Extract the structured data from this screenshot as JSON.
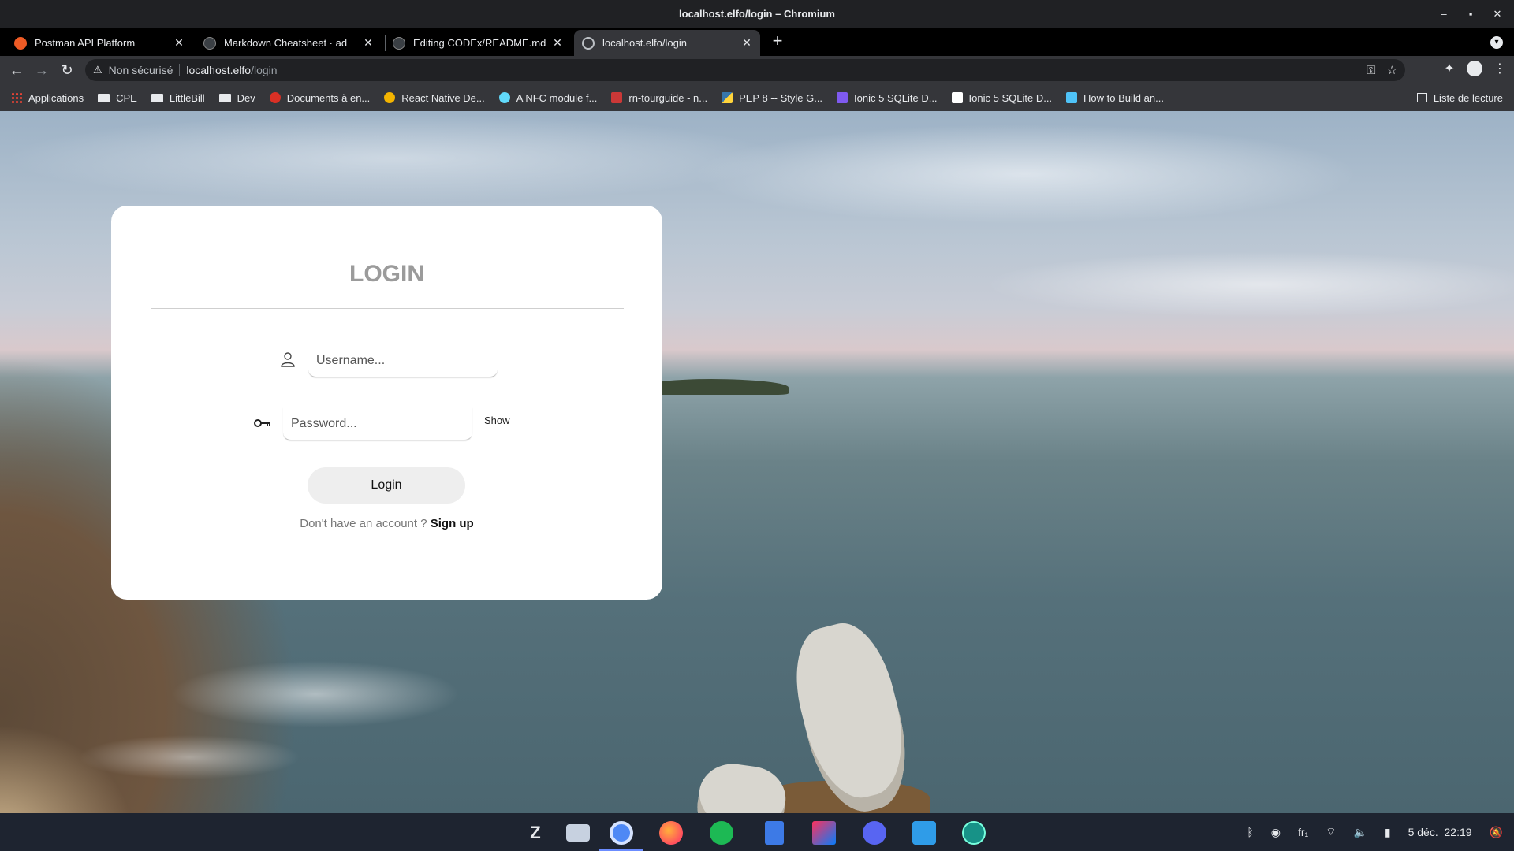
{
  "window": {
    "title": "localhost.elfo/login – Chromium",
    "controls": [
      "–",
      "▪",
      "✕"
    ]
  },
  "tabs": [
    {
      "label": "Postman API Platform",
      "favicon_color": "#ef5b25",
      "active": false
    },
    {
      "label": "Markdown Cheatsheet · ad",
      "favicon_color": "#24292e",
      "active": false
    },
    {
      "label": "Editing CODEx/README.md",
      "favicon_color": "#24292e",
      "active": false
    },
    {
      "label": "localhost.elfo/login",
      "favicon_color": "#9aa0a6",
      "active": true
    }
  ],
  "toolbar": {
    "back": "←",
    "forward": "→",
    "reload": "↻",
    "warning_icon": "⚠",
    "security_label": "Non sécurisé",
    "url_host": "localhost.elfo",
    "url_path": "/login",
    "key_icon": "⚿",
    "star_icon": "☆",
    "extensions_icon": "✦",
    "menu_icon": "⋮"
  },
  "bookmarks": [
    {
      "label": "Applications",
      "type": "apps",
      "color": "#ea4335"
    },
    {
      "label": "CPE",
      "type": "folder"
    },
    {
      "label": "LittleBill",
      "type": "folder"
    },
    {
      "label": "Dev",
      "type": "folder"
    },
    {
      "label": "Documents à en...",
      "type": "site",
      "color": "#d93025"
    },
    {
      "label": "React Native De...",
      "type": "site",
      "color": "#f4b400"
    },
    {
      "label": "A NFC module f...",
      "type": "site",
      "color": "#61dafb"
    },
    {
      "label": "rn-tourguide - n...",
      "type": "site",
      "color": "#cb3837"
    },
    {
      "label": "PEP 8 -- Style G...",
      "type": "site",
      "color": "#3776ab"
    },
    {
      "label": "Ionic 5 SQLite D...",
      "type": "site",
      "color": "#7f5af0"
    },
    {
      "label": "Ionic 5 SQLite D...",
      "type": "site",
      "color": "#ffffff"
    },
    {
      "label": "How to Build an...",
      "type": "site",
      "color": "#4fc3f7"
    }
  ],
  "reading_list": "Liste de lecture",
  "login": {
    "title": "LOGIN",
    "username_placeholder": "Username...",
    "password_placeholder": "Password...",
    "show_label": "Show",
    "login_button": "Login",
    "signup_prompt": "Don't have an account ? ",
    "signup_link": "Sign up",
    "username_icon": "user-icon",
    "password_icon": "key-icon"
  },
  "taskbar": {
    "apps": [
      {
        "name": "zorin-menu-icon",
        "color": "#e8eaed"
      },
      {
        "name": "files-icon",
        "color": "#c7d1e0"
      },
      {
        "name": "chromium-icon",
        "color": "#4e88f5",
        "active": true
      },
      {
        "name": "firefox-icon",
        "color": "#ff7139"
      },
      {
        "name": "spotify-icon",
        "color": "#1db954"
      },
      {
        "name": "editor-icon",
        "color": "#3d7ae6"
      },
      {
        "name": "intellij-icon",
        "color": "#fe315d"
      },
      {
        "name": "discord-icon",
        "color": "#5865f2"
      },
      {
        "name": "vscode-icon",
        "color": "#2f9ce8"
      },
      {
        "name": "gitkraken-icon",
        "color": "#179287"
      }
    ],
    "keyboard_layout": "fr₁",
    "date": "5 déc.",
    "time": "22:19"
  }
}
